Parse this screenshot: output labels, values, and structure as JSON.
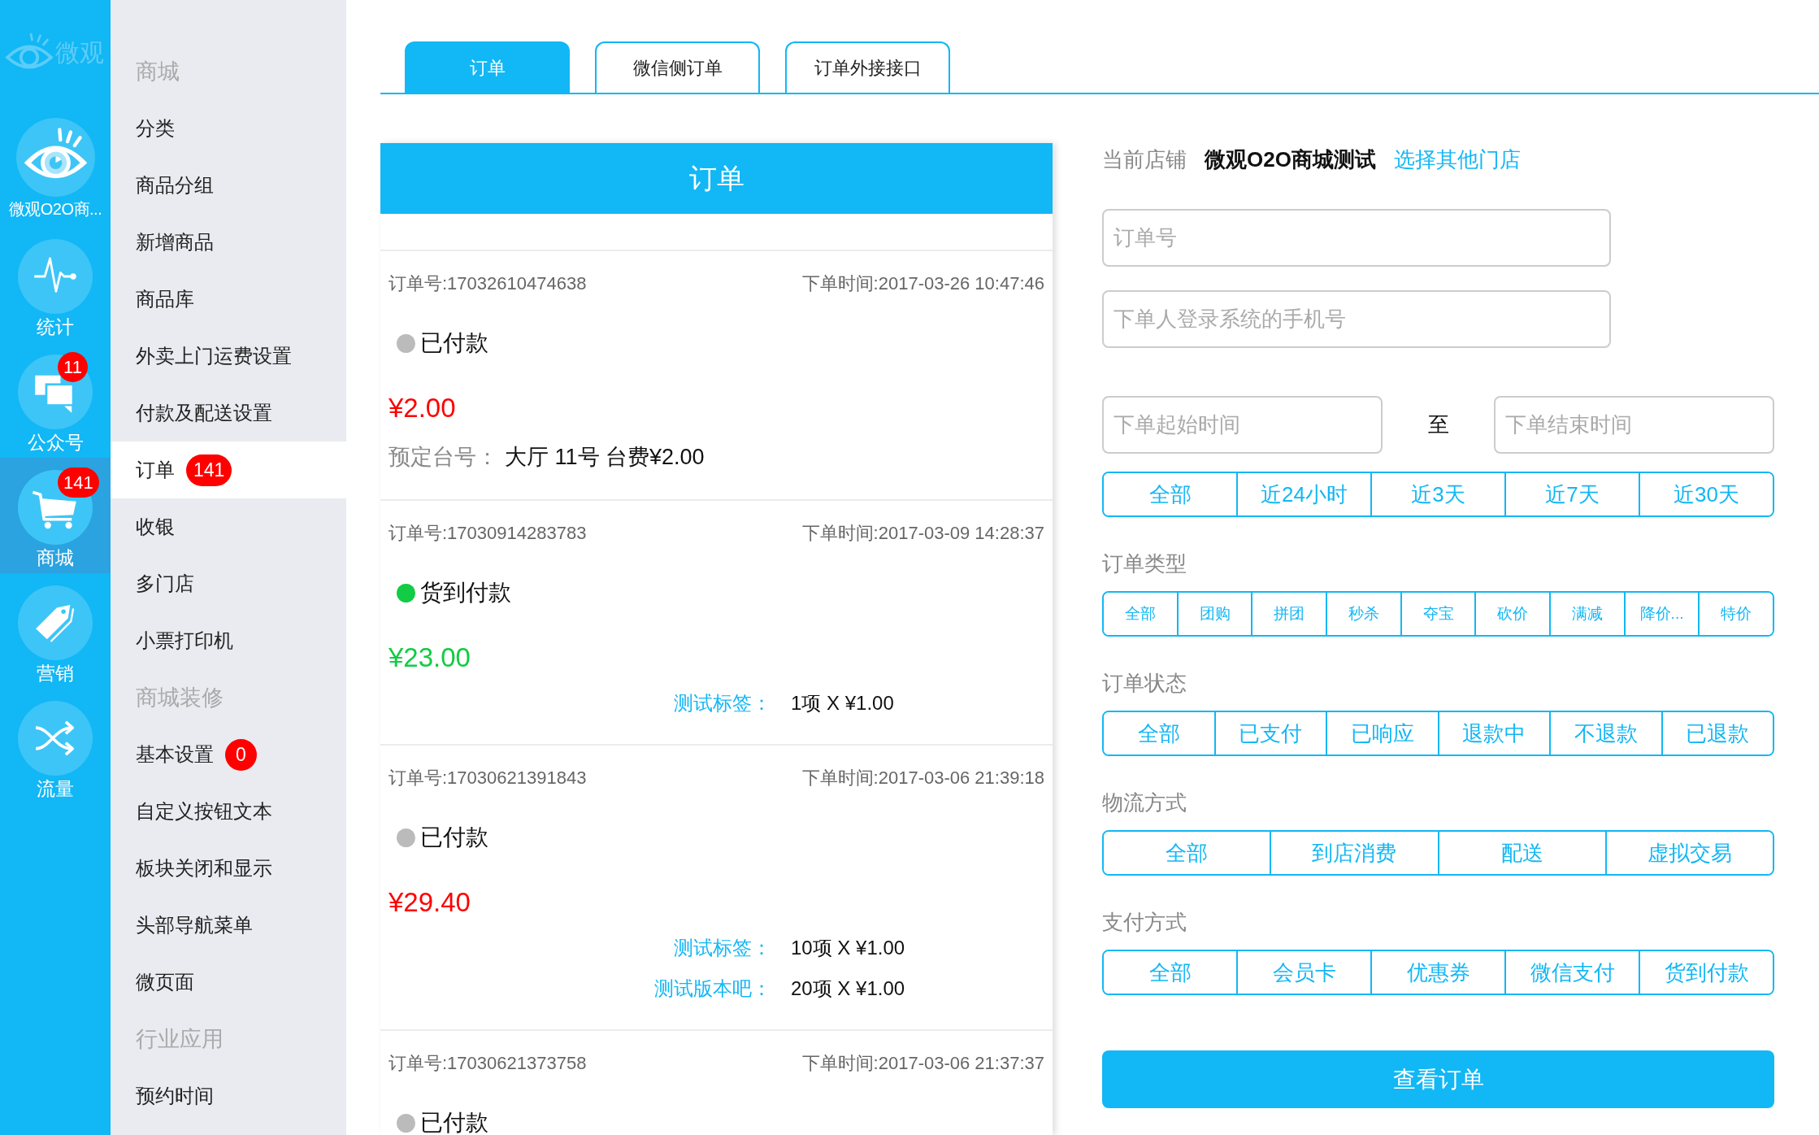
{
  "icon_bar": {
    "logo": "微观",
    "items": [
      {
        "kind": "store",
        "label": "微观O2O商...",
        "selected": false
      },
      {
        "kind": "stats",
        "label": "统计",
        "selected": false
      },
      {
        "kind": "wechat",
        "label": "公众号",
        "badge": "11",
        "selected": false
      },
      {
        "kind": "mall",
        "label": "商城",
        "badge": "141",
        "selected": true
      },
      {
        "kind": "marketing",
        "label": "营销",
        "selected": false
      },
      {
        "kind": "traffic",
        "label": "流量",
        "selected": false
      }
    ]
  },
  "sidebar": {
    "groups": [
      {
        "title": "商城",
        "items": [
          {
            "label": "分类",
            "selected": false
          },
          {
            "label": "商品分组",
            "selected": false
          },
          {
            "label": "新增商品",
            "selected": false
          },
          {
            "label": "商品库",
            "selected": false
          },
          {
            "label": "外卖上门运费设置",
            "selected": false
          },
          {
            "label": "付款及配送设置",
            "selected": false
          },
          {
            "label": "订单",
            "badge": "141",
            "selected": true
          },
          {
            "label": "收银",
            "selected": false
          },
          {
            "label": "多门店",
            "selected": false
          },
          {
            "label": "小票打印机",
            "selected": false
          }
        ]
      },
      {
        "title": "商城装修",
        "items": [
          {
            "label": "基本设置",
            "badge": "0",
            "selected": false
          },
          {
            "label": "自定义按钮文本",
            "selected": false
          },
          {
            "label": "板块关闭和显示",
            "selected": false
          },
          {
            "label": "头部导航菜单",
            "selected": false
          },
          {
            "label": "微页面",
            "selected": false
          }
        ]
      },
      {
        "title": "行业应用",
        "items": [
          {
            "label": "预约时间",
            "selected": false
          }
        ]
      }
    ]
  },
  "tabs": [
    {
      "label": "订单",
      "selected": true
    },
    {
      "label": "微信侧订单",
      "selected": false
    },
    {
      "label": "订单外接接口",
      "selected": false
    }
  ],
  "order_panel": {
    "title": "订单",
    "orders": [
      {
        "order_no": "订单号:17032610474638",
        "time": "下单时间:2017-03-26 10:47:46",
        "status": {
          "text": "已付款",
          "color": "#bbbbbb"
        },
        "price": {
          "text": "¥2.00",
          "color": "#ff0000"
        },
        "table": {
          "label": "预定台号：",
          "value": "大厅 11号 台费¥2.00"
        }
      },
      {
        "order_no": "订单号:17030914283783",
        "time": "下单时间:2017-03-09 14:28:37",
        "status": {
          "text": "货到付款",
          "color": "#11cc44"
        },
        "price": {
          "text": "¥23.00",
          "color": "#11cc44"
        },
        "items": [
          {
            "label": "测试标签：",
            "value": "1项 X ¥1.00"
          }
        ]
      },
      {
        "order_no": "订单号:17030621391843",
        "time": "下单时间:2017-03-06 21:39:18",
        "status": {
          "text": "已付款",
          "color": "#bbbbbb"
        },
        "price": {
          "text": "¥29.40",
          "color": "#ff0000"
        },
        "items": [
          {
            "label": "测试标签：",
            "value": "10项 X ¥1.00"
          },
          {
            "label": "测试版本吧：",
            "value": "20项 X ¥1.00"
          }
        ]
      },
      {
        "order_no": "订单号:17030621373758",
        "time": "下单时间:2017-03-06 21:37:37",
        "status": {
          "text": "已付款",
          "color": "#bbbbbb"
        }
      }
    ]
  },
  "filters": {
    "store": {
      "label": "当前店铺",
      "name": "微观O2O商城测试",
      "link": "选择其他门店"
    },
    "order_no": {
      "placeholder": "订单号"
    },
    "phone": {
      "placeholder": "下单人登录系统的手机号"
    },
    "date_range": {
      "start": {
        "placeholder": "下单起始时间"
      },
      "separator": "至",
      "end": {
        "placeholder": "下单结束时间"
      }
    },
    "time_presets": [
      {
        "label": "全部",
        "selected": false
      },
      {
        "label": "近24小时",
        "selected": false
      },
      {
        "label": "近3天",
        "selected": false
      },
      {
        "label": "近7天",
        "selected": false
      },
      {
        "label": "近30天",
        "selected": false
      }
    ],
    "groups": [
      {
        "title": "订单类型",
        "options": [
          {
            "label": "全部",
            "selected": false
          },
          {
            "label": "团购",
            "selected": false
          },
          {
            "label": "拼团",
            "selected": false
          },
          {
            "label": "秒杀",
            "selected": false
          },
          {
            "label": "夺宝",
            "selected": false
          },
          {
            "label": "砍价",
            "selected": false
          },
          {
            "label": "满减",
            "selected": false
          },
          {
            "label": "降价...",
            "selected": false
          },
          {
            "label": "特价",
            "selected": false
          }
        ]
      },
      {
        "title": "订单状态",
        "options": [
          {
            "label": "全部",
            "selected": false
          },
          {
            "label": "已支付",
            "selected": false
          },
          {
            "label": "已响应",
            "selected": false
          },
          {
            "label": "退款中",
            "selected": false
          },
          {
            "label": "不退款",
            "selected": false
          },
          {
            "label": "已退款",
            "selected": false
          }
        ]
      },
      {
        "title": "物流方式",
        "options": [
          {
            "label": "全部",
            "selected": false
          },
          {
            "label": "到店消费",
            "selected": false
          },
          {
            "label": "配送",
            "selected": false
          },
          {
            "label": "虚拟交易",
            "selected": false
          }
        ]
      },
      {
        "title": "支付方式",
        "options": [
          {
            "label": "全部",
            "selected": false
          },
          {
            "label": "会员卡",
            "selected": false
          },
          {
            "label": "优惠券",
            "selected": false
          },
          {
            "label": "微信支付",
            "selected": false
          },
          {
            "label": "货到付款",
            "selected": false
          }
        ]
      }
    ],
    "submit": "查看订单"
  }
}
